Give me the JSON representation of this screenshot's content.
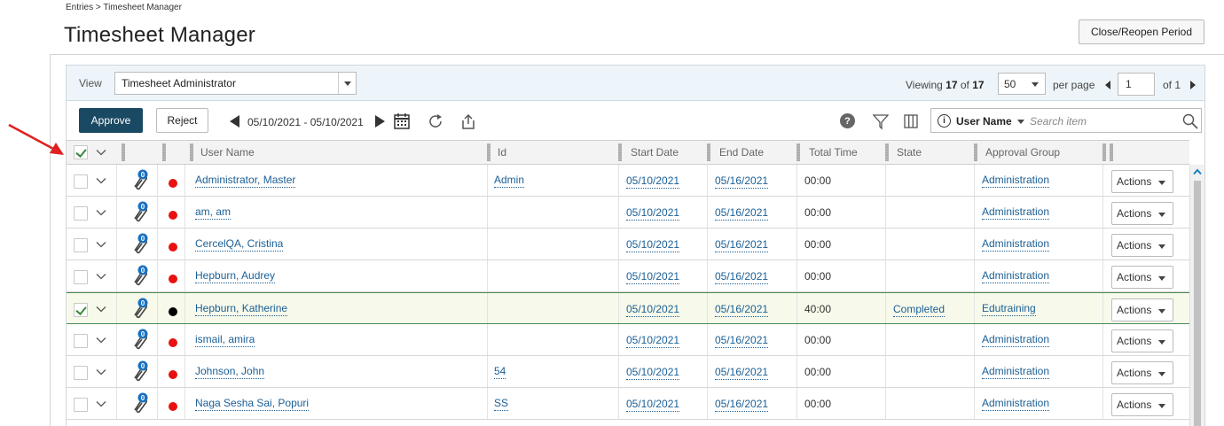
{
  "breadcrumb": "Entries > Timesheet Manager",
  "page_title": "Timesheet Manager",
  "close_reopen_label": "Close/Reopen Period",
  "view": {
    "label": "View",
    "selected": "Timesheet Administrator"
  },
  "paging": {
    "viewing_prefix": "Viewing",
    "viewing_count": "17",
    "viewing_of": "of",
    "viewing_total": "17",
    "per_page_value": "50",
    "per_page_label": "per page",
    "page_value": "1",
    "page_of": "of 1"
  },
  "toolbar": {
    "approve_label": "Approve",
    "reject_label": "Reject",
    "date_range": "05/10/2021 - 05/10/2021",
    "help_glyph": "?",
    "search_field": "User Name",
    "search_placeholder": "Search item",
    "info_glyph": "i"
  },
  "icons": {
    "calendar": "calendar-icon",
    "refresh": "refresh-icon",
    "export": "export-icon",
    "filter": "filter-icon",
    "columns": "columns-icon",
    "search": "search-icon",
    "attachment": "paperclip-icon"
  },
  "columns": {
    "user_name": "User Name",
    "id": "Id",
    "start_date": "Start Date",
    "end_date": "End Date",
    "total_time": "Total Time",
    "state": "State",
    "approval_group": "Approval Group"
  },
  "colors": {
    "approve_bg": "#1a4a63",
    "link": "#1a5f96",
    "status_red": "#e81010",
    "status_black": "#000000",
    "selected_row_bg": "#f7f9ea",
    "annotation_arrow": "#e02020"
  },
  "rows": [
    {
      "checked": false,
      "badge": "0",
      "status": "red",
      "user": "Administrator, Master",
      "id": "Admin",
      "start": "05/10/2021",
      "end": "05/16/2021",
      "total": "00:00",
      "state": "",
      "group": "Administration",
      "actions": "Actions"
    },
    {
      "checked": false,
      "badge": "0",
      "status": "red",
      "user": "am, am",
      "id": "",
      "start": "05/10/2021",
      "end": "05/16/2021",
      "total": "00:00",
      "state": "",
      "group": "Administration",
      "actions": "Actions"
    },
    {
      "checked": false,
      "badge": "0",
      "status": "red",
      "user": "CercelQA, Cristina",
      "id": "",
      "start": "05/10/2021",
      "end": "05/16/2021",
      "total": "00:00",
      "state": "",
      "group": "Administration",
      "actions": "Actions"
    },
    {
      "checked": false,
      "badge": "0",
      "status": "red",
      "user": "Hepburn, Audrey",
      "id": "",
      "start": "05/10/2021",
      "end": "05/16/2021",
      "total": "00:00",
      "state": "",
      "group": "Administration",
      "actions": "Actions"
    },
    {
      "checked": true,
      "badge": "0",
      "status": "black",
      "user": "Hepburn, Katherine",
      "id": "",
      "start": "05/10/2021",
      "end": "05/16/2021",
      "total": "40:00",
      "state": "Completed",
      "group": "Edutraining",
      "actions": "Actions"
    },
    {
      "checked": false,
      "badge": "0",
      "status": "red",
      "user": "ismail, amira",
      "id": "",
      "start": "05/10/2021",
      "end": "05/16/2021",
      "total": "00:00",
      "state": "",
      "group": "Administration",
      "actions": "Actions"
    },
    {
      "checked": false,
      "badge": "0",
      "status": "red",
      "user": "Johnson, John",
      "id": "54",
      "start": "05/10/2021",
      "end": "05/16/2021",
      "total": "00:00",
      "state": "",
      "group": "Administration",
      "actions": "Actions"
    },
    {
      "checked": false,
      "badge": "0",
      "status": "red",
      "user": "Naga Sesha Sai, Popuri",
      "id": "SS",
      "start": "05/10/2021",
      "end": "05/16/2021",
      "total": "00:00",
      "state": "",
      "group": "Administration",
      "actions": "Actions"
    }
  ]
}
